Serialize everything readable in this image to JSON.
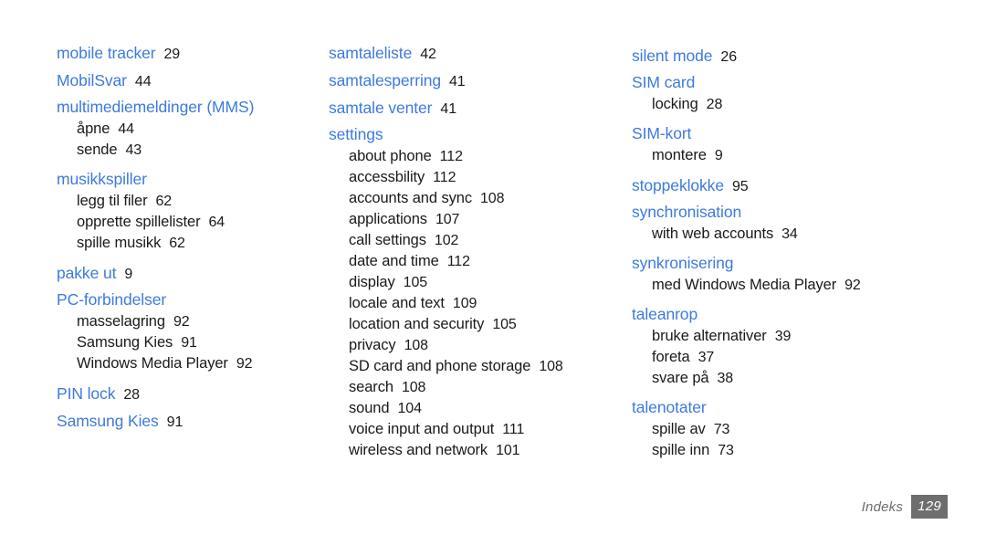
{
  "document": {
    "kind": "index-page",
    "accent_color": "#3d7ae0",
    "text_color": "#1a1a1a",
    "footer_gray": "#6e6e6e",
    "background": "#ffffff"
  },
  "columns": [
    {
      "id": "column-1",
      "groups": [
        {
          "term": "mobile tracker",
          "page": "29",
          "subs": []
        },
        {
          "term": "MobilSvar",
          "page": "44",
          "subs": []
        },
        {
          "term": "multimediemeldinger (MMS)",
          "page": "",
          "subs": [
            {
              "term": "åpne",
              "page": "44"
            },
            {
              "term": "sende",
              "page": "43"
            }
          ]
        },
        {
          "term": "musikkspiller",
          "page": "",
          "subs": [
            {
              "term": "legg til filer",
              "page": "62"
            },
            {
              "term": "opprette spillelister",
              "page": "64"
            },
            {
              "term": "spille musikk",
              "page": "62"
            }
          ]
        },
        {
          "term": "pakke ut",
          "page": "9",
          "subs": []
        },
        {
          "term": "PC-forbindelser",
          "page": "",
          "subs": [
            {
              "term": "masselagring",
              "page": "92"
            },
            {
              "term": "Samsung Kies",
              "page": "91"
            },
            {
              "term": "Windows Media Player",
              "page": "92"
            }
          ]
        },
        {
          "term": "PIN lock",
          "page": "28",
          "subs": []
        },
        {
          "term": "Samsung Kies",
          "page": "91",
          "subs": []
        }
      ]
    },
    {
      "id": "column-2",
      "groups": [
        {
          "term": "samtaleliste",
          "page": "42",
          "subs": []
        },
        {
          "term": "samtalesperring",
          "page": "41",
          "subs": []
        },
        {
          "term": "samtale venter",
          "page": "41",
          "subs": []
        },
        {
          "term": "settings",
          "page": "",
          "subs": [
            {
              "term": "about phone",
              "page": "112"
            },
            {
              "term": "accessbility",
              "page": "112"
            },
            {
              "term": "accounts and sync",
              "page": "108"
            },
            {
              "term": "applications",
              "page": "107"
            },
            {
              "term": "call settings",
              "page": "102"
            },
            {
              "term": "date and time",
              "page": "112"
            },
            {
              "term": "display",
              "page": "105"
            },
            {
              "term": "locale and text",
              "page": "109"
            },
            {
              "term": "location and security",
              "page": "105"
            },
            {
              "term": "privacy",
              "page": "108"
            },
            {
              "term": "SD card and phone storage",
              "page": "108"
            },
            {
              "term": "search",
              "page": "108"
            },
            {
              "term": "sound",
              "page": "104"
            },
            {
              "term": "voice input and output",
              "page": "111"
            },
            {
              "term": "wireless and network",
              "page": "101"
            }
          ]
        }
      ]
    },
    {
      "id": "column-3",
      "groups": [
        {
          "term": "silent mode",
          "page": "26",
          "subs": []
        },
        {
          "term": "SIM card",
          "page": "",
          "subs": [
            {
              "term": "locking",
              "page": "28"
            }
          ]
        },
        {
          "term": "SIM-kort",
          "page": "",
          "subs": [
            {
              "term": "montere",
              "page": "9"
            }
          ]
        },
        {
          "term": "stoppeklokke",
          "page": "95",
          "subs": []
        },
        {
          "term": "synchronisation",
          "page": "",
          "subs": [
            {
              "term": "with web accounts",
              "page": "34"
            }
          ]
        },
        {
          "term": "synkronisering",
          "page": "",
          "subs": [
            {
              "term": "med Windows Media Player",
              "page": "92"
            }
          ]
        },
        {
          "term": "taleanrop",
          "page": "",
          "subs": [
            {
              "term": "bruke alternativer",
              "page": "39"
            },
            {
              "term": "foreta",
              "page": "37"
            },
            {
              "term": "svare på",
              "page": "38"
            }
          ]
        },
        {
          "term": "talenotater",
          "page": "",
          "subs": [
            {
              "term": "spille av",
              "page": "73"
            },
            {
              "term": "spille inn",
              "page": "73"
            }
          ]
        }
      ]
    }
  ],
  "footer": {
    "label": "Indeks",
    "page_number": "129"
  }
}
